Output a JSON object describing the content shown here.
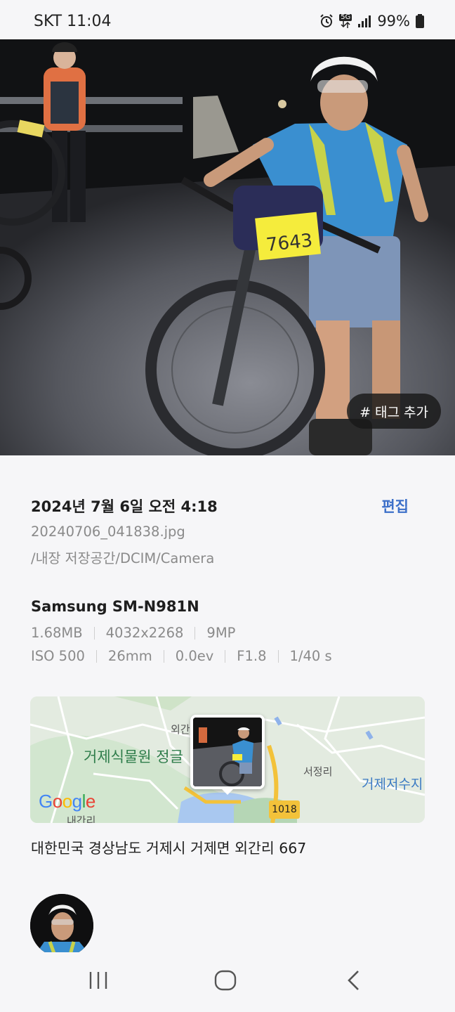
{
  "status_bar": {
    "carrier_time": "SKT 11:04",
    "network": "5G",
    "battery": "99%",
    "icons": [
      "alarm-icon",
      "data-arrows-icon",
      "signal-icon",
      "battery-icon"
    ]
  },
  "photo": {
    "bib_number": "7643",
    "tag_button_label": "# 태그 추가"
  },
  "details": {
    "date": "2024년 7월 6일 오전 4:18",
    "edit_label": "편집",
    "filename": "20240706_041838.jpg",
    "path": "/내장 저장공간/DCIM/Camera",
    "device": "Samsung SM-N981N",
    "specs_row1": [
      "1.68MB",
      "4032x2268",
      "9MP"
    ],
    "specs_row2": [
      "ISO 500",
      "26mm",
      "0.0ev",
      "F1.8",
      "1/40 s"
    ]
  },
  "map": {
    "labels": {
      "oegan": "외간",
      "garden": "거제식물원 정글",
      "seojeong": "서정리",
      "reservoir": "거제저수지",
      "naegan": "내간리",
      "route": "1018",
      "google": "Google"
    },
    "colors": {
      "google_blue": "#4285F4",
      "google_red": "#EA4335",
      "google_yellow": "#FBBC05",
      "google_green": "#34A853"
    }
  },
  "address": "대한민국 경상남도 거제시 거제면 외간리 667",
  "nav": {
    "recent_icon": "recent-apps-icon",
    "home_icon": "home-icon",
    "back_icon": "back-icon"
  }
}
